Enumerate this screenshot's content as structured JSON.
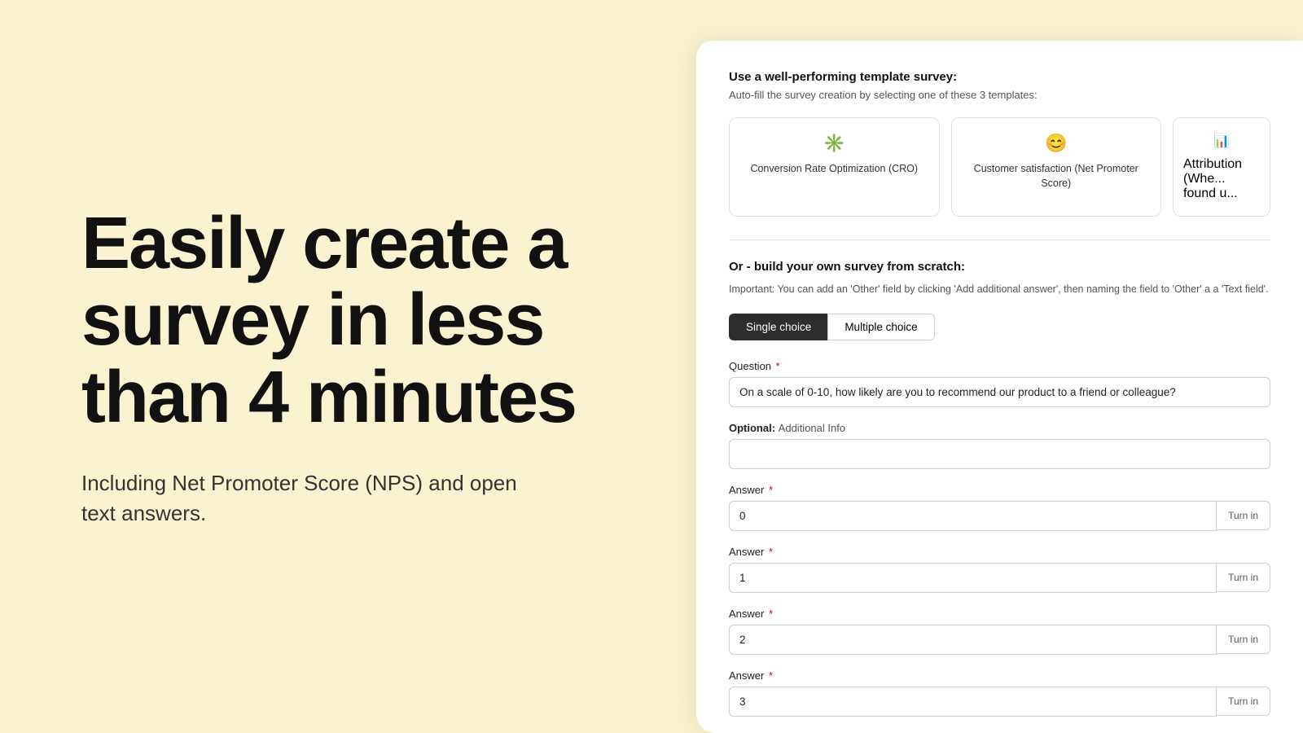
{
  "left": {
    "headline": "Easily create a survey in less than 4 minutes",
    "subtext": "Including Net Promoter Score (NPS) and open text answers."
  },
  "right": {
    "template_section_title": "Use a well-performing template survey:",
    "template_section_subtitle": "Auto-fill the survey creation by selecting one of these 3 templates:",
    "templates": [
      {
        "name": "Conversion Rate Optimization (CRO)",
        "icon": "✳️"
      },
      {
        "name": "Customer satisfaction (Net Promoter Score)",
        "icon": "😊"
      },
      {
        "name": "Attribution (Whe... found u...",
        "icon": "📊"
      }
    ],
    "build_title": "Or - build your own survey from scratch:",
    "important_note": "Important: You can add an 'Other' field by clicking 'Add additional answer', then naming the field to 'Other' a a 'Text field'.",
    "toggle": {
      "single_choice": "Single choice",
      "multiple_choice": "Multiple choice"
    },
    "question_label": "Question",
    "question_placeholder": "On a scale of 0-10, how likely are you to recommend our product to a friend or colleague?",
    "optional_label": "Optional:",
    "optional_sub": "Additional Info",
    "answers": [
      {
        "label": "Answer",
        "value": "0",
        "turn_in": "Turn in"
      },
      {
        "label": "Answer",
        "value": "1",
        "turn_in": "Turn in"
      },
      {
        "label": "Answer",
        "value": "2",
        "turn_in": "Turn in"
      },
      {
        "label": "Answer",
        "value": "3",
        "turn_in": "Turn in"
      }
    ]
  }
}
